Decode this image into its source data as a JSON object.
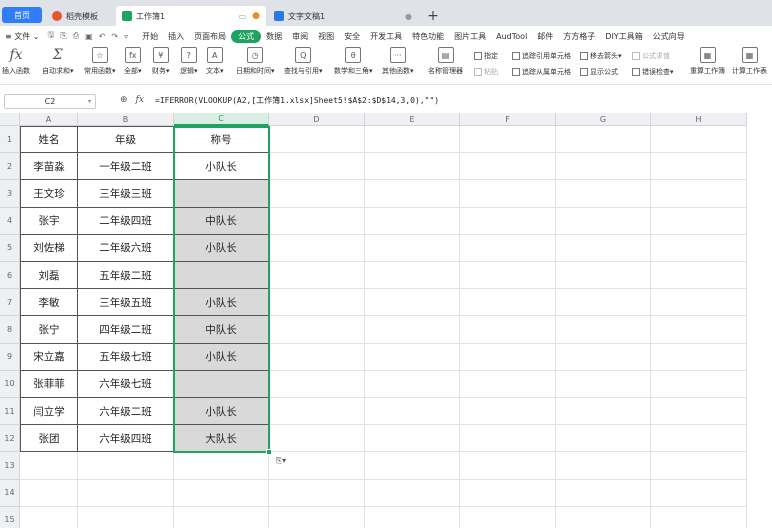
{
  "tabs": {
    "home": "首页",
    "template": "稻壳模板",
    "workbook": "工作簿1",
    "doc": "文字文稿1",
    "add": "+"
  },
  "menu": {
    "file": "≡ 文件 ⌄",
    "items": [
      "开始",
      "插入",
      "页面布局",
      "公式",
      "数据",
      "审阅",
      "视图",
      "安全",
      "开发工具",
      "特色功能",
      "图片工具",
      "AudTool",
      "邮件",
      "方方格子",
      "DIY工具箱",
      "公式向导"
    ],
    "active_index": 3
  },
  "ribbon": {
    "buttons": [
      {
        "icon": "fx",
        "label": "插入函数"
      },
      {
        "icon": "Σ",
        "label": "自动求和▾"
      },
      {
        "icon": "☆",
        "label": "常用函数▾"
      },
      {
        "icon": "fx",
        "label": "全部▾"
      },
      {
        "icon": "¥",
        "label": "财务▾"
      },
      {
        "icon": "?",
        "label": "逻辑▾"
      },
      {
        "icon": "A",
        "label": "文本▾"
      },
      {
        "icon": "◷",
        "label": "日期和时间▾"
      },
      {
        "icon": "Q",
        "label": "查找与引用▾"
      },
      {
        "icon": "θ",
        "label": "数学和三角▾"
      },
      {
        "icon": "···",
        "label": "其他函数▾"
      },
      {
        "icon": "▤",
        "label": "名称管理器"
      },
      {
        "icon": "▦",
        "label": "重算工作簿"
      },
      {
        "icon": "▦",
        "label": "计算工作表"
      }
    ],
    "small": {
      "designate": "指定",
      "paste": "粘贴",
      "trace_precedents": "追踪引用单元格",
      "trace_dependents": "追踪从属单元格",
      "remove_arrows": "移去箭头▾",
      "show_formulas": "显示公式",
      "formula_evaluate": "公式求值",
      "error_check": "错误检查▾"
    }
  },
  "formula_bar": {
    "cell_ref": "C2",
    "formula": "=IFERROR(VLOOKUP(A2,[工作簿1.xlsx]Sheet5!$A$2:$D$14,3,0),\"\")"
  },
  "grid": {
    "columns": [
      "A",
      "B",
      "C",
      "D",
      "E",
      "F",
      "G",
      "H"
    ],
    "rows": [
      "1",
      "2",
      "3",
      "4",
      "5",
      "6",
      "7",
      "8",
      "9",
      "10",
      "11",
      "12",
      "13",
      "14",
      "15"
    ],
    "header": [
      "姓名",
      "年级",
      "称号"
    ],
    "data": [
      [
        "李苗淼",
        "一年级二班",
        "小队长"
      ],
      [
        "王文珍",
        "三年级三班",
        ""
      ],
      [
        "张宇",
        "二年级四班",
        "中队长"
      ],
      [
        "刘佐梯",
        "二年级六班",
        "小队长"
      ],
      [
        "刘磊",
        "五年级二班",
        ""
      ],
      [
        "李敏",
        "三年级五班",
        "小队长"
      ],
      [
        "张宁",
        "四年级二班",
        "中队长"
      ],
      [
        "宋立嘉",
        "五年级七班",
        "小队长"
      ],
      [
        "张菲菲",
        "六年级七班",
        ""
      ],
      [
        "闫立学",
        "六年级二班",
        "小队长"
      ],
      [
        "张团",
        "六年级四班",
        "大队长"
      ]
    ]
  },
  "colors": {
    "accent": "#1ea362",
    "home_tab": "#2f7ef7",
    "shade": "#d9d9d9"
  }
}
